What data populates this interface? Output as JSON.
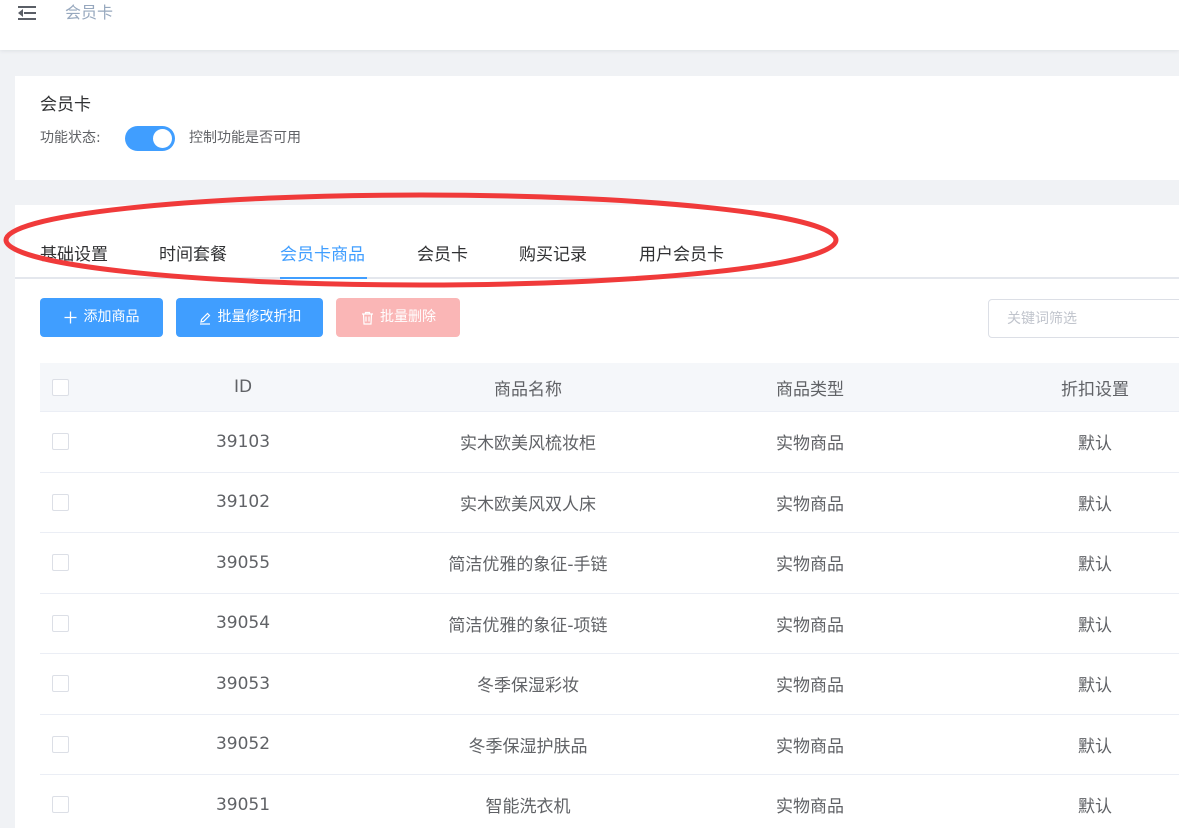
{
  "header": {
    "menu_icon": "hamburger-icon",
    "breadcrumb": "会员卡"
  },
  "feature": {
    "title": "会员卡",
    "status_label": "功能状态:",
    "status_on": true,
    "status_desc": "控制功能是否可用"
  },
  "tabs": [
    {
      "label": "基础设置",
      "active": false
    },
    {
      "label": "时间套餐",
      "active": false
    },
    {
      "label": "会员卡商品",
      "active": true
    },
    {
      "label": "会员卡",
      "active": false
    },
    {
      "label": "购买记录",
      "active": false
    },
    {
      "label": "用户会员卡",
      "active": false
    }
  ],
  "toolbar": {
    "add_label": "添加商品",
    "edit_label": "批量修改折扣",
    "delete_label": "批量删除",
    "search_placeholder": "关键词筛选"
  },
  "table": {
    "columns": [
      "ID",
      "商品名称",
      "商品类型",
      "折扣设置"
    ],
    "rows": [
      {
        "id": "39103",
        "name": "实木欧美风梳妆柜",
        "type": "实物商品",
        "discount": "默认"
      },
      {
        "id": "39102",
        "name": "实木欧美风双人床",
        "type": "实物商品",
        "discount": "默认"
      },
      {
        "id": "39055",
        "name": "简洁优雅的象征-手链",
        "type": "实物商品",
        "discount": "默认"
      },
      {
        "id": "39054",
        "name": "简洁优雅的象征-项链",
        "type": "实物商品",
        "discount": "默认"
      },
      {
        "id": "39053",
        "name": "冬季保湿彩妆",
        "type": "实物商品",
        "discount": "默认"
      },
      {
        "id": "39052",
        "name": "冬季保湿护肤品",
        "type": "实物商品",
        "discount": "默认"
      },
      {
        "id": "39051",
        "name": "智能洗衣机",
        "type": "实物商品",
        "discount": "默认"
      }
    ]
  },
  "colors": {
    "primary": "#409eff",
    "danger_disabled": "#fab6b6",
    "annotation": "#f03a3a"
  }
}
